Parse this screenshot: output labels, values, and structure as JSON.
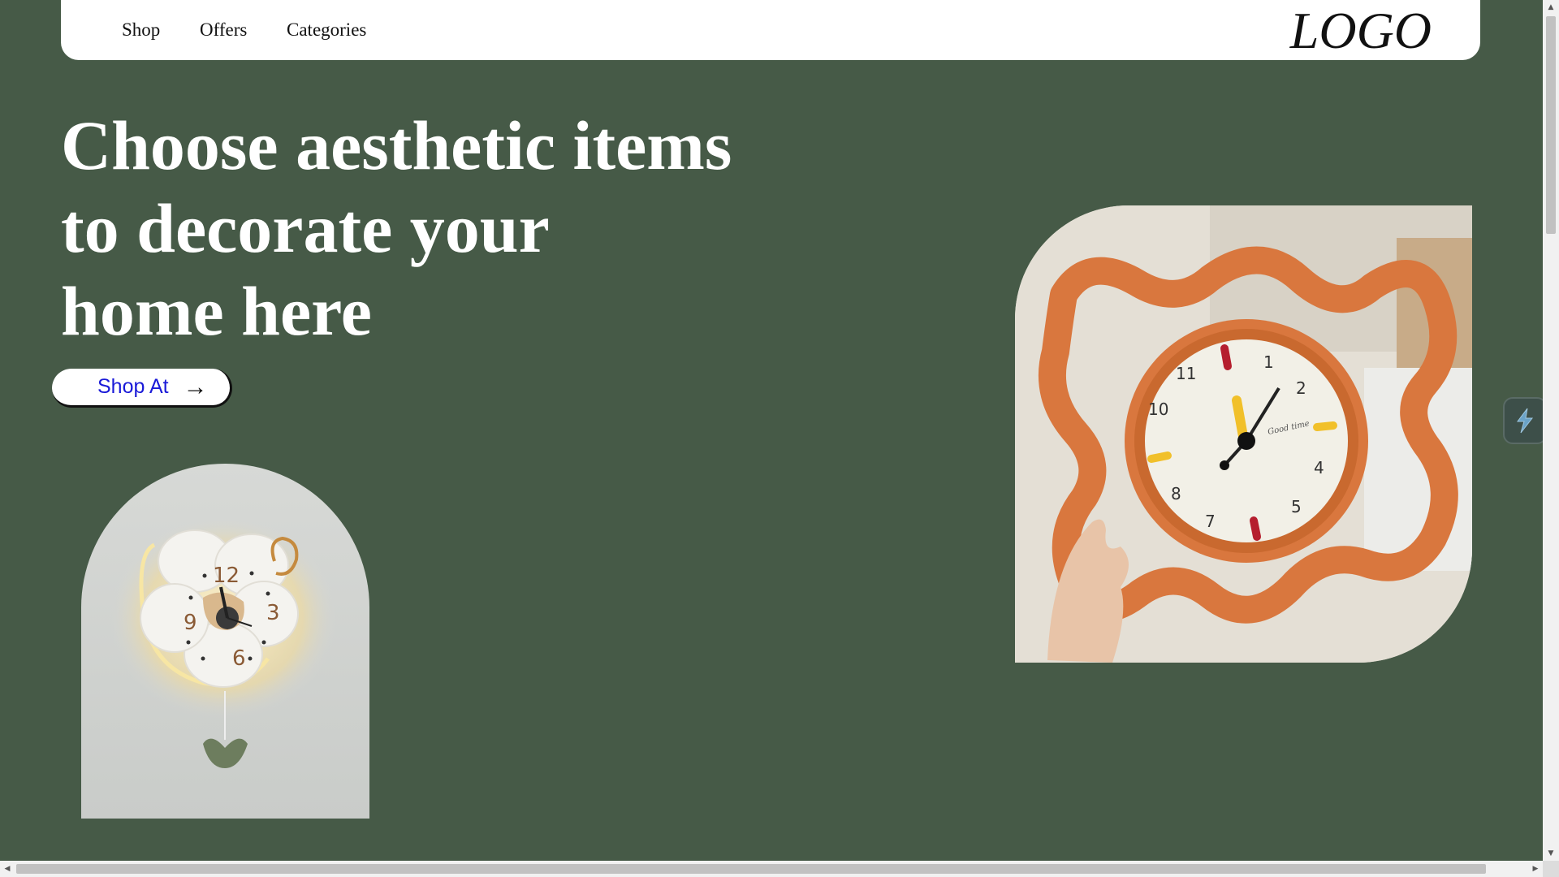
{
  "nav": {
    "items": [
      {
        "label": "Shop"
      },
      {
        "label": "Offers"
      },
      {
        "label": "Categories"
      }
    ],
    "logo": "LOGO"
  },
  "hero": {
    "headline_lines": [
      "Choose aesthetic items",
      "to decorate your",
      "home here"
    ],
    "cta_label": "Shop At",
    "cta_arrow": "→"
  },
  "images": {
    "left_clock_numbers": [
      "12",
      "3",
      "6",
      "9"
    ],
    "right_clock_numbers": [
      "1",
      "2",
      "4",
      "5",
      "7",
      "8",
      "10",
      "11"
    ],
    "right_clock_text": "Good time"
  },
  "scrollbars": {
    "up": "▲",
    "down": "▼",
    "left": "◀",
    "right": "▶"
  },
  "colors": {
    "background": "#465a47",
    "nav_bg": "#ffffff",
    "cta_text": "#1a1ad8",
    "clock_frame": "#d9773e"
  },
  "icons": {
    "floating": "lightning-bolt-icon",
    "cta": "arrow-right-icon"
  }
}
